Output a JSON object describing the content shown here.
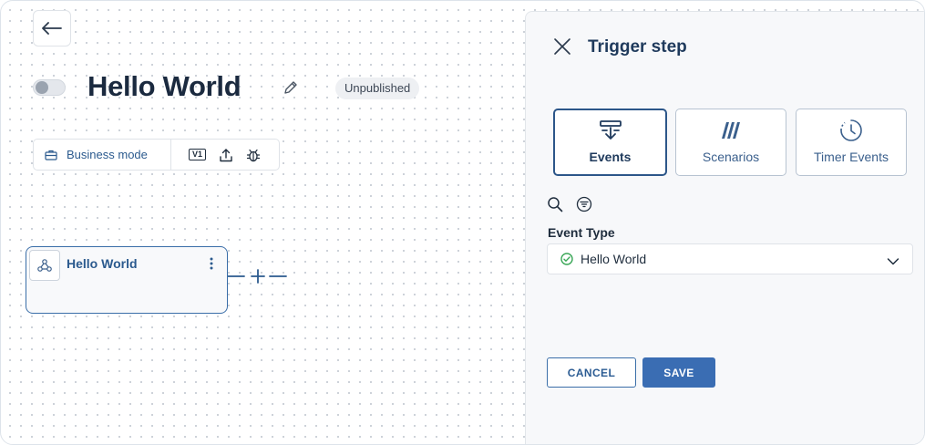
{
  "flow": {
    "title": "Hello World",
    "status": "Unpublished",
    "published": false
  },
  "toolbar": {
    "mode_label": "Business mode",
    "version": "V1"
  },
  "node": {
    "title": "Hello World"
  },
  "panel": {
    "title": "Trigger step",
    "tabs": [
      {
        "label": "Events",
        "active": true
      },
      {
        "label": "Scenarios",
        "active": false
      },
      {
        "label": "Timer Events",
        "active": false
      }
    ],
    "field_label": "Event Type",
    "selected_event": "Hello World",
    "cancel_label": "CANCEL",
    "save_label": "SAVE"
  },
  "colors": {
    "accent": "#3a6db3",
    "accent_dark": "#2c5689",
    "success": "#3aa757",
    "text": "#1f2d3d"
  },
  "icons": {
    "back": "arrow-left-icon",
    "edit": "pencil-icon",
    "mode": "briefcase-icon",
    "export": "upload-icon",
    "debug": "bug-icon",
    "node": "webhook-icon",
    "menu": "kebab-menu-icon",
    "add": "plus-icon",
    "close": "close-icon",
    "events": "events-icon",
    "scenarios": "scenarios-icon",
    "timer": "clock-icon",
    "search": "search-icon",
    "filter": "filter-icon",
    "check": "check-circle-icon",
    "chevron": "chevron-down-icon"
  }
}
